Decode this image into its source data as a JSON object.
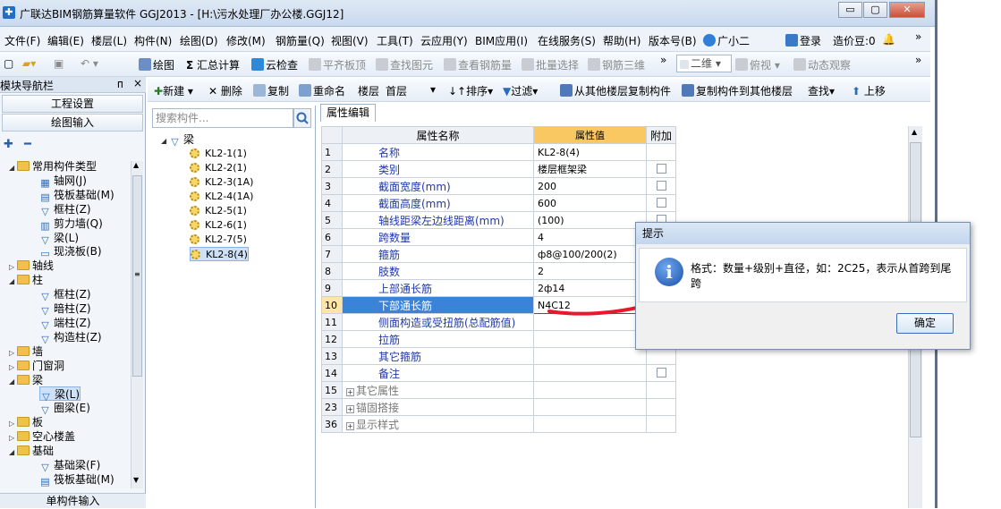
{
  "window": {
    "title": "广联达BIM钢筋算量软件 GGJ2013 - [H:\\污水处理厂办公楼.GGJ12]",
    "min": "▭",
    "max": "▢",
    "close": "✕"
  },
  "menu": [
    "文件(F)",
    "编辑(E)",
    "楼层(L)",
    "构件(N)",
    "绘图(D)",
    "修改(M)",
    "钢筋量(Q)",
    "视图(V)",
    "工具(T)",
    "云应用(Y)",
    "BIM应用(I)",
    "在线服务(S)",
    "帮助(H)",
    "版本号(B)",
    "广小二",
    "登录",
    "造价豆:0",
    "»"
  ],
  "toolbar": {
    "draw": "绘图",
    "sum_calc": "汇总计算",
    "cloud_check": "云检查",
    "flat_top": "平齐板顶",
    "find_elem": "查找图元",
    "view_rebar": "查看钢筋量",
    "batch_select": "批量选择",
    "rebar_3d": "钢筋三维",
    "more": "»",
    "view_mode": "二维",
    "top_view": "俯视",
    "dynamic_view": "动态观察",
    "more2": "»"
  },
  "nav": {
    "header": "模块导航栏",
    "pin": "ᴨ",
    "close": "×",
    "project_settings": "工程设置",
    "drawing_input": "绘图输入",
    "footer": "单构件输入",
    "tree": [
      {
        "label": "常用构件类型",
        "level": 0,
        "type": "folder",
        "exp": "◢"
      },
      {
        "label": "轴网(J)",
        "level": 1,
        "type": "grid"
      },
      {
        "label": "筏板基础(M)",
        "level": 1,
        "type": "raft"
      },
      {
        "label": "框柱(Z)",
        "level": 1,
        "type": "col"
      },
      {
        "label": "剪力墙(Q)",
        "level": 1,
        "type": "wall"
      },
      {
        "label": "梁(L)",
        "level": 1,
        "type": "beam"
      },
      {
        "label": "现浇板(B)",
        "level": 1,
        "type": "slab"
      },
      {
        "label": "轴线",
        "level": 0,
        "type": "folder",
        "exp": "▷"
      },
      {
        "label": "柱",
        "level": 0,
        "type": "folder",
        "exp": "◢"
      },
      {
        "label": "框柱(Z)",
        "level": 1,
        "type": "col"
      },
      {
        "label": "暗柱(Z)",
        "level": 1,
        "type": "col"
      },
      {
        "label": "端柱(Z)",
        "level": 1,
        "type": "col"
      },
      {
        "label": "构造柱(Z)",
        "level": 1,
        "type": "col"
      },
      {
        "label": "墙",
        "level": 0,
        "type": "folder",
        "exp": "▷"
      },
      {
        "label": "门窗洞",
        "level": 0,
        "type": "folder",
        "exp": "▷"
      },
      {
        "label": "梁",
        "level": 0,
        "type": "folder",
        "exp": "◢"
      },
      {
        "label": "梁(L)",
        "level": 1,
        "type": "beam",
        "selected": true
      },
      {
        "label": "圈梁(E)",
        "level": 1,
        "type": "beam"
      },
      {
        "label": "板",
        "level": 0,
        "type": "folder",
        "exp": "▷"
      },
      {
        "label": "空心楼盖",
        "level": 0,
        "type": "folder",
        "exp": "▷"
      },
      {
        "label": "基础",
        "level": 0,
        "type": "folder",
        "exp": "◢"
      },
      {
        "label": "基础梁(F)",
        "level": 1,
        "type": "beam"
      },
      {
        "label": "筏板基础(M)",
        "level": 1,
        "type": "raft"
      }
    ]
  },
  "comp_toolbar": {
    "new": "新建",
    "delete": "删除",
    "copy": "复制",
    "rename": "重命名",
    "floor_label": "楼层",
    "floor_value": "首层",
    "sort": "排序",
    "filter": "过滤",
    "copy_from": "从其他楼层复制构件",
    "copy_to": "复制构件到其他楼层",
    "find": "查找",
    "move_up": "上移"
  },
  "comp_list": {
    "search_placeholder": "搜索构件...",
    "root": "梁",
    "items": [
      "KL2-1(1)",
      "KL2-2(1)",
      "KL2-3(1A)",
      "KL2-4(1A)",
      "KL2-5(1)",
      "KL2-6(1)",
      "KL2-7(5)",
      "KL2-8(4)"
    ],
    "selected_index": 7
  },
  "prop": {
    "tab": "属性编辑",
    "col_name": "属性名称",
    "col_value": "属性值",
    "col_extra": "附加",
    "rows": [
      {
        "num": "1",
        "name": "名称",
        "value": "KL2-8(4)",
        "check": false
      },
      {
        "num": "2",
        "name": "类别",
        "value": "楼层框架梁",
        "check": true
      },
      {
        "num": "3",
        "name": "截面宽度(mm)",
        "value": "200",
        "check": true
      },
      {
        "num": "4",
        "name": "截面高度(mm)",
        "value": "600",
        "check": true
      },
      {
        "num": "5",
        "name": "轴线距梁左边线距离(mm)",
        "value": "(100)",
        "check": true
      },
      {
        "num": "6",
        "name": "跨数量",
        "value": "4",
        "check": true
      },
      {
        "num": "7",
        "name": "箍筋",
        "value": "ф8@100/200(2)",
        "check": true
      },
      {
        "num": "8",
        "name": "肢数",
        "value": "2",
        "check": true
      },
      {
        "num": "9",
        "name": "上部通长筋",
        "value": "2ф14",
        "check": true
      },
      {
        "num": "10",
        "name": "下部通长筋",
        "value": "N4C12",
        "check": true,
        "selected": true
      },
      {
        "num": "11",
        "name": "侧面构造或受扭筋(总配筋值)",
        "value": "",
        "check": false
      },
      {
        "num": "12",
        "name": "拉筋",
        "value": "",
        "check": false
      },
      {
        "num": "13",
        "name": "其它箍筋",
        "value": "",
        "check": false
      },
      {
        "num": "14",
        "name": "备注",
        "value": "",
        "check": true
      },
      {
        "num": "15",
        "name": "其它属性",
        "value": "",
        "check": false,
        "group": true
      },
      {
        "num": "23",
        "name": "锚固搭接",
        "value": "",
        "check": false,
        "group": true
      },
      {
        "num": "36",
        "name": "显示样式",
        "value": "",
        "check": false,
        "group": true
      }
    ]
  },
  "dialog": {
    "title": "提示",
    "icon": "i",
    "message": "格式：数量+级别+直径，如：2C25，表示从首跨到尾跨",
    "ok": "确定"
  },
  "colors": {
    "accent": "#3b83d9",
    "header_value": "#f9c862",
    "arrow": "#e8192c"
  }
}
